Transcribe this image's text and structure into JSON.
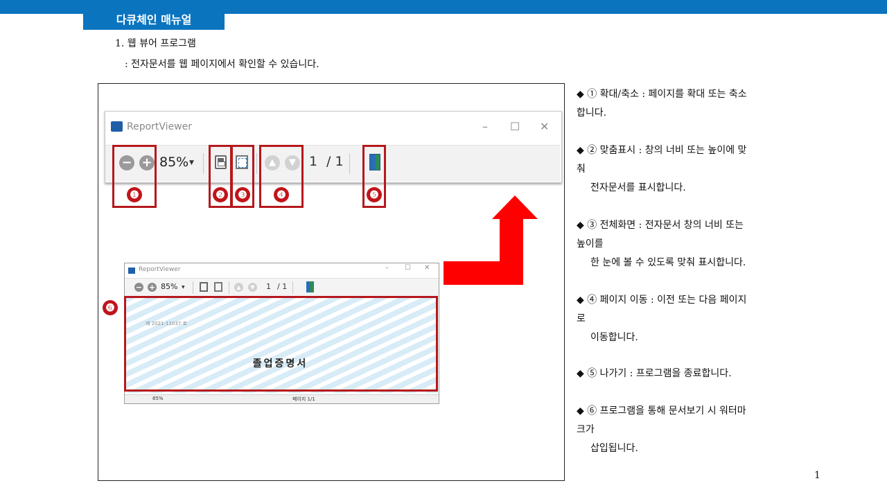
{
  "header": {
    "tab_label": "다큐체인 매뉴얼"
  },
  "section": {
    "heading": "1. 웹 뷰어 프로그램",
    "subtext": ": 전자문서를 웹 페이지에서 확인할 수 있습니다."
  },
  "viewer_large": {
    "title": "ReportViewer",
    "zoom": "85%",
    "page_current": "1",
    "page_total": "/ 1",
    "minimize_glyph": "–",
    "maximize_glyph": "☐",
    "close_glyph": "✕"
  },
  "markers": [
    "❶",
    "❷",
    "❸",
    "❹",
    "❺",
    "❻"
  ],
  "viewer_small": {
    "title": "ReportViewer",
    "zoom": "85%",
    "page_current": "1",
    "page_total": "/ 1",
    "doc_date": "제 2021-11037 호",
    "doc_title": "졸업증명서",
    "status_zoom": "85%",
    "status_page": "페이지 1/1"
  },
  "descriptions": [
    {
      "lines": [
        "◆ ① 확대/축소 : 페이지를 확대 또는 축소",
        "합니다."
      ]
    },
    {
      "lines": [
        "◆ ② 맞춤표시 : 창의 너비 또는 높이에 맞",
        "춰"
      ],
      "cont": "전자문서를 표시합니다."
    },
    {
      "lines": [
        "◆ ③ 전체화면 : 전자문서 창의 너비 또는",
        "높이를"
      ],
      "cont": "한 눈에 볼 수 있도록 맞춰 표시합니다."
    },
    {
      "lines": [
        "◆ ④ 페이지 이동 : 이전 또는 다음 페이지",
        "로"
      ],
      "cont": "이동합니다."
    },
    {
      "lines": [
        "◆ ⑤ 나가기 : 프로그램을 종료합니다."
      ]
    },
    {
      "lines": [
        "◆ ⑥ 프로그램을 통해 문서보기 시 워터마",
        "크가"
      ],
      "cont": "삽입됩니다."
    }
  ],
  "page_number": "1"
}
